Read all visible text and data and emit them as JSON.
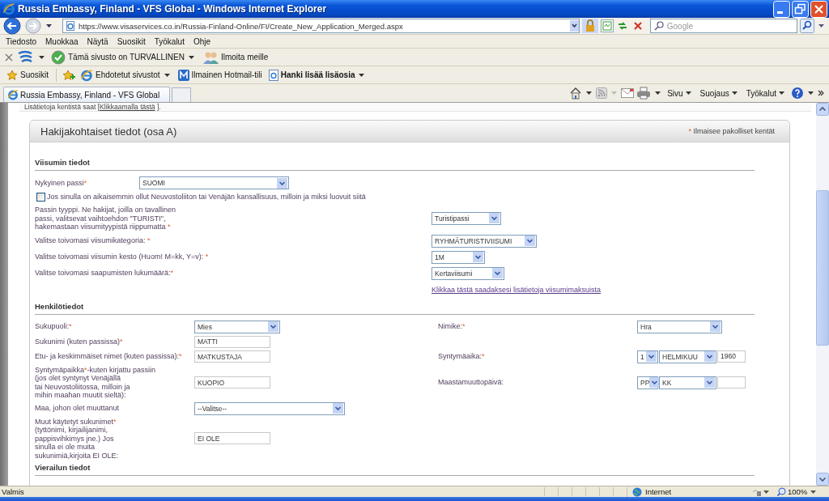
{
  "window": {
    "title": "Russia Embassy, Finland - VFS Global - Windows Internet Explorer"
  },
  "address_bar": {
    "url": "https://www.visaservices.co.in/Russia-Finland-Online/FI/Create_New_Application_Merged.aspx",
    "search_placeholder": "Google"
  },
  "menu": [
    "Tiedosto",
    "Muokkaa",
    "Näytä",
    "Suosikit",
    "Työkalut",
    "Ohje"
  ],
  "toolbar": {
    "security": "Tämä sivusto on TURVALLINEN",
    "report": "Ilmoita meille"
  },
  "favorites_bar": {
    "label": "Suosikit",
    "links": [
      {
        "kind": "suggested",
        "text": "Ehdotetut sivustot",
        "dropdown": true,
        "bold": false
      },
      {
        "kind": "hotmail",
        "text": "Ilmainen Hotmail-tili",
        "dropdown": false,
        "bold": false
      },
      {
        "kind": "addons",
        "text": "Hanki lisää lisäosia",
        "dropdown": true,
        "bold": true
      }
    ]
  },
  "tabs": [
    {
      "label": "Russia Embassy, Finland - VFS Global",
      "selected": true
    }
  ],
  "command_bar": [
    "Sivu",
    "Suojaus",
    "Työkalut"
  ],
  "page": {
    "top_note": {
      "before": "Lisätietoja kentistä saat [",
      "link": "Klikkaamalla tästä",
      "after": " ]."
    },
    "panel": {
      "title": "Hakijakohtaiset tiedot (osa A)",
      "required_note": {
        "mark": "*",
        "text": "Ilmaisee pakolliset kentät"
      },
      "visa_section": {
        "heading": "Viisumin tiedot",
        "rows": [
          {
            "kind": "field",
            "label": "Nykyinen passi",
            "mark": "*",
            "control": {
              "kind": "select",
              "value": "SUOMI"
            }
          },
          {
            "kind": "checkbox",
            "label": "Jos sinulla on aikaisemmin ollut Neuvostoliiton tai Venäjän kansallisuus, milloin ja miksi luovuit siitä",
            "checked": false
          },
          {
            "kind": "field",
            "label": "Passin tyyppi. Ne hakijat, joilla on tavallinen\npassi, valitsevat vaihtoehdon \"TURISTI\",\nhakemastaan viisumityypistä riippumatta ",
            "mark": "*",
            "control": {
              "kind": "select",
              "value": "Turistipassi"
            }
          },
          {
            "kind": "field",
            "label": "Valitse toivomasi viisumikategoria: ",
            "mark": "*",
            "control": {
              "kind": "select",
              "value": "RYHMÄTURISTIVIISUMI"
            }
          },
          {
            "kind": "field",
            "label": "Valitse toivomasi viisumin kesto (Huom! M=kk, Y=v): ",
            "mark": "*",
            "control": {
              "kind": "select",
              "value": "1M"
            }
          },
          {
            "kind": "field",
            "label": "Valitse toivomasi saapumisten lukumäärä:",
            "mark": "*",
            "control": {
              "kind": "select",
              "value": "Kertaviisumi"
            }
          },
          {
            "kind": "link",
            "label": "Klikkaa tästä saadaksesi lisätietoja viisumimaksuista"
          }
        ]
      },
      "personal_section": {
        "heading": "Henkilötiedot",
        "rows": [
          {
            "left": {
              "label": "Sukupuoli:",
              "mark": "*",
              "control": {
                "kind": "select",
                "value": "Mies"
              }
            },
            "right": {
              "label": "Nimike:",
              "mark": "*",
              "control": {
                "kind": "select",
                "value": "Hra"
              }
            }
          },
          {
            "left": {
              "label": "Sukunimi (kuten passissa)",
              "mark": "*",
              "control": {
                "kind": "text",
                "value": "MATTI"
              }
            }
          },
          {
            "left": {
              "label": "Etu- ja keskimmäiset nimet (kuten passissa):",
              "mark": "*",
              "control": {
                "kind": "text",
                "value": "MATKUSTAJA"
              }
            },
            "right": {
              "label": "Syntymäaika:",
              "mark": "*",
              "control": {
                "kind": "date",
                "day": "1",
                "month": "HELMIKUU",
                "year": "1960"
              }
            }
          },
          {
            "left": {
              "label": "Syntymäpaikka",
              "mark": "*",
              "label_after": "-kuten kirjattu passiin\n(jos olet syntynyt Venäjällä\ntai Neuvostoliitossa, milloin ja\nmihin maahan muutit sieltä):",
              "control": {
                "kind": "text",
                "value": "KUOPIO"
              }
            },
            "right": {
              "label": "Maastamuuttopäivä:",
              "control": {
                "kind": "date",
                "day": "PP",
                "month": "KK"
              }
            }
          },
          {
            "left": {
              "label": "Maa, johon olet muuttanut",
              "control": {
                "kind": "select",
                "value": "--Valitse--"
              }
            }
          },
          {
            "left": {
              "label": "Muut käytetyt sukunimet",
              "mark": "*",
              "label_after": "\n(tyttönimi, kirjailijanimi,\npappisvihkimys jne.) Jos\nsinulla ei ole muita\nsukunimiä,kirjoita EI OLE:",
              "control": {
                "kind": "text",
                "value": "EI OLE"
              }
            }
          }
        ]
      },
      "visit_section": {
        "heading": "Vierailun tiedot"
      }
    }
  },
  "status_bar": {
    "text": "Valmis",
    "zone": "Internet",
    "zoom": "100%"
  }
}
